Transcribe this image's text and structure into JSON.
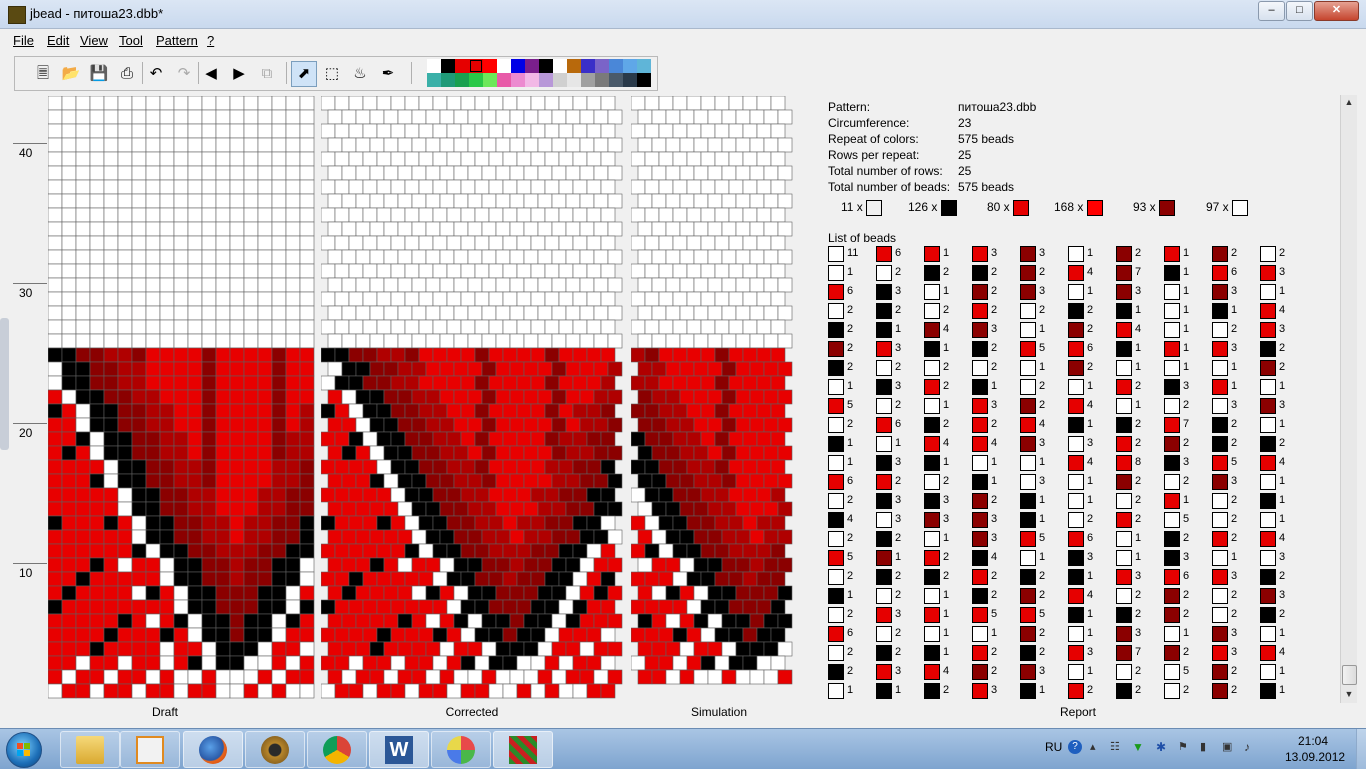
{
  "window": {
    "title": "jbead - питоша23.dbb*"
  },
  "menu": [
    "File",
    "Edit",
    "View",
    "Tool",
    "Pattern",
    "?"
  ],
  "toolbar": {
    "buttons": [
      "new-file",
      "open-file",
      "save",
      "print",
      "undo",
      "redo",
      "scroll-left",
      "scroll-right",
      "copy",
      "select-pointer",
      "select-rect",
      "fill-bucket",
      "color-picker"
    ],
    "palette_row1": [
      "#ffffff",
      "#000000",
      "#e60000",
      "#e60000",
      "#ff0000",
      "#ffffff",
      "#0000e6",
      "#7a1f8c",
      "#000000",
      "#ffffff",
      "#b8690c",
      "#3a2fc8",
      "#7a64c8",
      "#4a87d8",
      "#5fa7e8",
      "#5fb5d8"
    ],
    "palette_row2": [
      "#3ab0a8",
      "#1f9a78",
      "#19a050",
      "#29c848",
      "#6ce85a",
      "#e85aa8",
      "#ec8ad0",
      "#f2b8e6",
      "#b898d8",
      "#d0d0d0",
      "#e6e6e6",
      "#a0a0a0",
      "#7a7a7a",
      "#4a5a6a",
      "#2a3a4a",
      "#000000"
    ]
  },
  "ruler": [
    "40",
    "30",
    "20",
    "10"
  ],
  "panes": {
    "draft": "Draft",
    "corrected": "Corrected",
    "simulation": "Simulation",
    "report": "Report"
  },
  "report": {
    "rows": [
      {
        "label": "Pattern:",
        "value": "питоша23.dbb"
      },
      {
        "label": "Circumference:",
        "value": "23"
      },
      {
        "label": "Repeat of colors:",
        "value": "575 beads"
      },
      {
        "label": "Rows per repeat:",
        "value": "25"
      },
      {
        "label": "Total number of rows:",
        "value": "25"
      },
      {
        "label": "Total number of beads:",
        "value": "575 beads"
      }
    ],
    "summary": [
      {
        "count": "11 x",
        "color": "#f0f0f0"
      },
      {
        "count": "126 x",
        "color": "#000000"
      },
      {
        "count": "80 x",
        "color": "#e60000"
      },
      {
        "count": "168 x",
        "color": "#ff0000"
      },
      {
        "count": "93 x",
        "color": "#8b0000"
      },
      {
        "count": "97 x",
        "color": "#ffffff"
      }
    ],
    "list_title": "List of beads",
    "bead_columns": [
      [
        [
          "W",
          "11"
        ],
        [
          "W",
          "1"
        ],
        [
          "R",
          "6"
        ],
        [
          "W",
          "2"
        ],
        [
          "K",
          "2"
        ],
        [
          "D",
          "2"
        ],
        [
          "K",
          "2"
        ],
        [
          "W",
          "1"
        ],
        [
          "R",
          "5"
        ],
        [
          "W",
          "2"
        ],
        [
          "K",
          "1"
        ],
        [
          "W",
          "1"
        ],
        [
          "R",
          "6"
        ],
        [
          "W",
          "2"
        ],
        [
          "K",
          "4"
        ],
        [
          "W",
          "2"
        ],
        [
          "R",
          "5"
        ],
        [
          "W",
          "2"
        ],
        [
          "K",
          "1"
        ],
        [
          "W",
          "2"
        ],
        [
          "R",
          "6"
        ],
        [
          "W",
          "2"
        ],
        [
          "K",
          "2"
        ],
        [
          "W",
          "1"
        ]
      ],
      [
        [
          "R",
          "6"
        ],
        [
          "W",
          "2"
        ],
        [
          "K",
          "3"
        ],
        [
          "K",
          "2"
        ],
        [
          "K",
          "1"
        ],
        [
          "R",
          "3"
        ],
        [
          "W",
          "2"
        ],
        [
          "K",
          "3"
        ],
        [
          "W",
          "2"
        ],
        [
          "R",
          "6"
        ],
        [
          "W",
          "1"
        ],
        [
          "K",
          "3"
        ],
        [
          "R",
          "2"
        ],
        [
          "K",
          "3"
        ],
        [
          "W",
          "3"
        ],
        [
          "K",
          "2"
        ],
        [
          "D",
          "1"
        ],
        [
          "K",
          "2"
        ],
        [
          "W",
          "2"
        ],
        [
          "R",
          "3"
        ],
        [
          "W",
          "2"
        ],
        [
          "K",
          "2"
        ],
        [
          "R",
          "3"
        ],
        [
          "K",
          "1"
        ]
      ],
      [
        [
          "R",
          "1"
        ],
        [
          "K",
          "2"
        ],
        [
          "W",
          "1"
        ],
        [
          "W",
          "2"
        ],
        [
          "D",
          "4"
        ],
        [
          "K",
          "1"
        ],
        [
          "W",
          "2"
        ],
        [
          "R",
          "2"
        ],
        [
          "W",
          "1"
        ],
        [
          "K",
          "2"
        ],
        [
          "R",
          "4"
        ],
        [
          "K",
          "1"
        ],
        [
          "W",
          "2"
        ],
        [
          "K",
          "3"
        ],
        [
          "D",
          "3"
        ],
        [
          "W",
          "1"
        ],
        [
          "R",
          "2"
        ],
        [
          "K",
          "2"
        ],
        [
          "W",
          "1"
        ],
        [
          "R",
          "1"
        ],
        [
          "W",
          "1"
        ],
        [
          "K",
          "1"
        ],
        [
          "R",
          "4"
        ],
        [
          "K",
          "2"
        ]
      ],
      [
        [
          "R",
          "3"
        ],
        [
          "K",
          "2"
        ],
        [
          "D",
          "2"
        ],
        [
          "R",
          "2"
        ],
        [
          "D",
          "3"
        ],
        [
          "K",
          "2"
        ],
        [
          "W",
          "2"
        ],
        [
          "K",
          "1"
        ],
        [
          "R",
          "3"
        ],
        [
          "R",
          "2"
        ],
        [
          "R",
          "4"
        ],
        [
          "W",
          "1"
        ],
        [
          "K",
          "1"
        ],
        [
          "D",
          "2"
        ],
        [
          "D",
          "3"
        ],
        [
          "D",
          "3"
        ],
        [
          "K",
          "4"
        ],
        [
          "R",
          "2"
        ],
        [
          "K",
          "2"
        ],
        [
          "R",
          "5"
        ],
        [
          "W",
          "1"
        ],
        [
          "R",
          "2"
        ],
        [
          "D",
          "2"
        ],
        [
          "R",
          "3"
        ]
      ],
      [
        [
          "D",
          "3"
        ],
        [
          "D",
          "2"
        ],
        [
          "D",
          "3"
        ],
        [
          "W",
          "2"
        ],
        [
          "W",
          "1"
        ],
        [
          "R",
          "5"
        ],
        [
          "W",
          "1"
        ],
        [
          "W",
          "2"
        ],
        [
          "D",
          "2"
        ],
        [
          "R",
          "4"
        ],
        [
          "D",
          "3"
        ],
        [
          "W",
          "1"
        ],
        [
          "W",
          "3"
        ],
        [
          "K",
          "1"
        ],
        [
          "K",
          "1"
        ],
        [
          "R",
          "5"
        ],
        [
          "W",
          "1"
        ],
        [
          "K",
          "2"
        ],
        [
          "D",
          "2"
        ],
        [
          "R",
          "5"
        ],
        [
          "D",
          "2"
        ],
        [
          "K",
          "2"
        ],
        [
          "D",
          "3"
        ],
        [
          "K",
          "1"
        ]
      ],
      [
        [
          "W",
          "1"
        ],
        [
          "R",
          "4"
        ],
        [
          "W",
          "1"
        ],
        [
          "K",
          "2"
        ],
        [
          "D",
          "2"
        ],
        [
          "R",
          "6"
        ],
        [
          "D",
          "2"
        ],
        [
          "W",
          "1"
        ],
        [
          "R",
          "4"
        ],
        [
          "K",
          "1"
        ],
        [
          "W",
          "3"
        ],
        [
          "R",
          "4"
        ],
        [
          "W",
          "1"
        ],
        [
          "W",
          "1"
        ],
        [
          "W",
          "2"
        ],
        [
          "R",
          "6"
        ],
        [
          "K",
          "3"
        ],
        [
          "K",
          "1"
        ],
        [
          "R",
          "4"
        ],
        [
          "K",
          "1"
        ],
        [
          "W",
          "1"
        ],
        [
          "R",
          "3"
        ],
        [
          "W",
          "1"
        ],
        [
          "R",
          "2"
        ]
      ],
      [
        [
          "D",
          "2"
        ],
        [
          "D",
          "7"
        ],
        [
          "D",
          "3"
        ],
        [
          "K",
          "1"
        ],
        [
          "R",
          "4"
        ],
        [
          "K",
          "1"
        ],
        [
          "W",
          "1"
        ],
        [
          "R",
          "2"
        ],
        [
          "W",
          "1"
        ],
        [
          "K",
          "2"
        ],
        [
          "R",
          "2"
        ],
        [
          "R",
          "8"
        ],
        [
          "D",
          "2"
        ],
        [
          "W",
          "2"
        ],
        [
          "R",
          "2"
        ],
        [
          "W",
          "1"
        ],
        [
          "W",
          "1"
        ],
        [
          "R",
          "3"
        ],
        [
          "W",
          "2"
        ],
        [
          "K",
          "2"
        ],
        [
          "D",
          "3"
        ],
        [
          "D",
          "7"
        ],
        [
          "W",
          "2"
        ],
        [
          "K",
          "2"
        ]
      ],
      [
        [
          "R",
          "1"
        ],
        [
          "K",
          "1"
        ],
        [
          "W",
          "1"
        ],
        [
          "W",
          "1"
        ],
        [
          "W",
          "1"
        ],
        [
          "R",
          "1"
        ],
        [
          "W",
          "1"
        ],
        [
          "K",
          "3"
        ],
        [
          "W",
          "2"
        ],
        [
          "R",
          "7"
        ],
        [
          "D",
          "2"
        ],
        [
          "K",
          "3"
        ],
        [
          "W",
          "2"
        ],
        [
          "R",
          "1"
        ],
        [
          "W",
          "5"
        ],
        [
          "K",
          "2"
        ],
        [
          "K",
          "3"
        ],
        [
          "R",
          "6"
        ],
        [
          "D",
          "2"
        ],
        [
          "D",
          "2"
        ],
        [
          "W",
          "1"
        ],
        [
          "D",
          "2"
        ],
        [
          "W",
          "5"
        ],
        [
          "W",
          "2"
        ]
      ],
      [
        [
          "D",
          "2"
        ],
        [
          "R",
          "6"
        ],
        [
          "D",
          "3"
        ],
        [
          "K",
          "1"
        ],
        [
          "W",
          "2"
        ],
        [
          "R",
          "3"
        ],
        [
          "W",
          "1"
        ],
        [
          "R",
          "1"
        ],
        [
          "W",
          "3"
        ],
        [
          "K",
          "2"
        ],
        [
          "K",
          "2"
        ],
        [
          "R",
          "5"
        ],
        [
          "D",
          "3"
        ],
        [
          "W",
          "2"
        ],
        [
          "W",
          "2"
        ],
        [
          "R",
          "2"
        ],
        [
          "W",
          "1"
        ],
        [
          "R",
          "3"
        ],
        [
          "W",
          "2"
        ],
        [
          "W",
          "2"
        ],
        [
          "D",
          "3"
        ],
        [
          "R",
          "3"
        ],
        [
          "D",
          "2"
        ],
        [
          "D",
          "2"
        ]
      ],
      [
        [
          "W",
          "2"
        ],
        [
          "R",
          "3"
        ],
        [
          "W",
          "1"
        ],
        [
          "R",
          "4"
        ],
        [
          "R",
          "3"
        ],
        [
          "K",
          "2"
        ],
        [
          "D",
          "2"
        ],
        [
          "W",
          "1"
        ],
        [
          "D",
          "3"
        ],
        [
          "W",
          "1"
        ],
        [
          "K",
          "2"
        ],
        [
          "R",
          "4"
        ],
        [
          "W",
          "1"
        ],
        [
          "K",
          "1"
        ],
        [
          "W",
          "1"
        ],
        [
          "R",
          "4"
        ],
        [
          "W",
          "3"
        ],
        [
          "K",
          "2"
        ],
        [
          "D",
          "3"
        ],
        [
          "K",
          "2"
        ],
        [
          "W",
          "1"
        ],
        [
          "R",
          "4"
        ],
        [
          "W",
          "1"
        ],
        [
          "K",
          "1"
        ]
      ]
    ]
  },
  "taskbar": {
    "apps": [
      "windows-explorer",
      "media-player",
      "firefox",
      "scanner-app",
      "chrome",
      "word",
      "paint",
      "jbead"
    ],
    "language": "RU",
    "time": "21:04",
    "date": "13.09.2012"
  }
}
